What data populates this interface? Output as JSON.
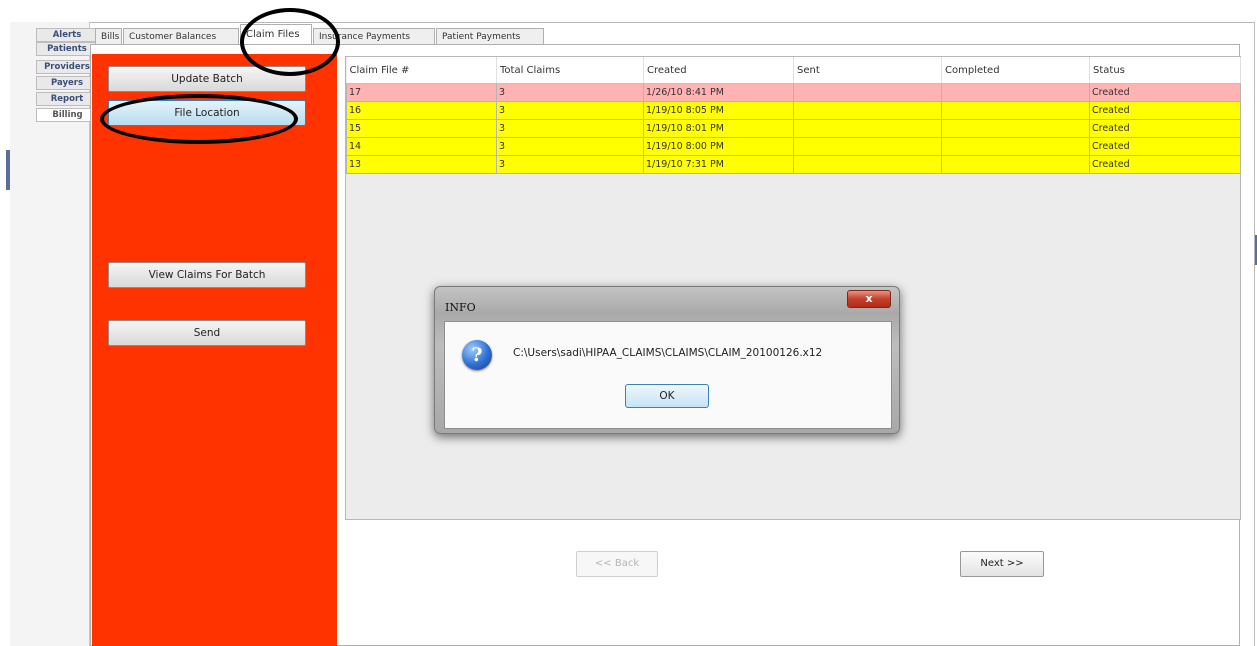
{
  "nav": {
    "items": [
      {
        "label": "Alerts"
      },
      {
        "label": "Patients"
      },
      {
        "label": "Providers"
      },
      {
        "label": "Payers"
      },
      {
        "label": "Report"
      },
      {
        "label": "Billing"
      }
    ],
    "active": "Billing"
  },
  "tabs": [
    {
      "label": "Bills"
    },
    {
      "label": "Customer Balances"
    },
    {
      "label": "Claim Files"
    },
    {
      "label": "Insurance Payments"
    },
    {
      "label": "Patient Payments"
    }
  ],
  "active_tab": "Claim Files",
  "actions": {
    "update_batch": "Update Batch",
    "file_location": "File Location",
    "view_claims": "View Claims For Batch",
    "send": "Send"
  },
  "table": {
    "columns": [
      "Claim File #",
      "Total Claims",
      "Created",
      "Sent",
      "Completed",
      "Status"
    ],
    "rows": [
      {
        "claim_file": "17",
        "total_claims": "3",
        "created": "1/26/10 8:41 PM",
        "sent": "",
        "completed": "",
        "status": "Created"
      },
      {
        "claim_file": "16",
        "total_claims": "3",
        "created": "1/19/10 8:05 PM",
        "sent": "",
        "completed": "",
        "status": "Created"
      },
      {
        "claim_file": "15",
        "total_claims": "3",
        "created": "1/19/10 8:01 PM",
        "sent": "",
        "completed": "",
        "status": "Created"
      },
      {
        "claim_file": "14",
        "total_claims": "3",
        "created": "1/19/10 8:00 PM",
        "sent": "",
        "completed": "",
        "status": "Created"
      },
      {
        "claim_file": "13",
        "total_claims": "3",
        "created": "1/19/10 7:31 PM",
        "sent": "",
        "completed": "",
        "status": "Created"
      }
    ]
  },
  "pager": {
    "back": "<< Back",
    "next": "Next >>"
  },
  "dialog": {
    "title": "INFO",
    "close": "x",
    "icon": "question-icon",
    "message": "C:\\Users\\sadi\\HIPAA_CLAIMS\\CLAIMS\\CLAIM_20100126.x12",
    "ok": "OK"
  },
  "colors": {
    "action_panel": "#ff3300",
    "selected_row": "#ffb3b3",
    "row": "#ffff00"
  }
}
